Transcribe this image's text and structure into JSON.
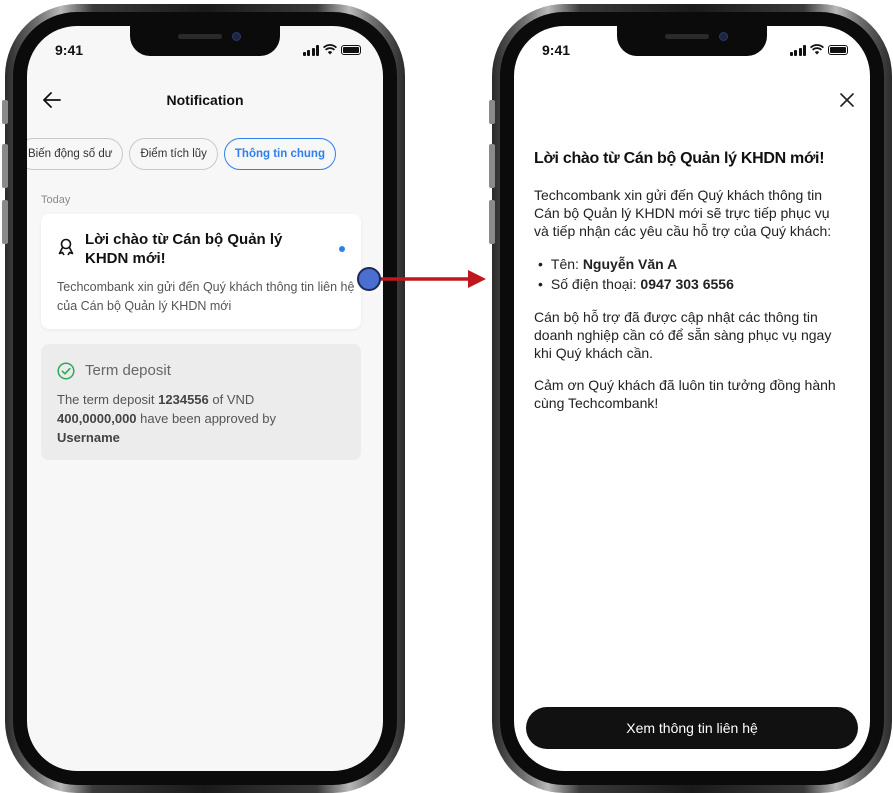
{
  "left_phone": {
    "status_time": "9:41",
    "header": {
      "title": "Notification"
    },
    "tabs": [
      {
        "label": "Biến động số dư",
        "active": false
      },
      {
        "label": "Điểm tích lũy",
        "active": false
      },
      {
        "label": "Thông tin chung",
        "active": true
      }
    ],
    "section_label": "Today",
    "notifications": [
      {
        "icon": "badge-icon",
        "title": "Lời chào từ Cán bộ Quản lý KHDN mới!",
        "body": "Techcombank xin gửi đến Quý khách thông tin liên hệ của Cán bộ Quản lý KHDN mới",
        "unread": true
      },
      {
        "icon": "check-circle-icon",
        "title": "Term deposit",
        "body_parts": {
          "p1": "The term deposit ",
          "id": "1234556",
          "p2": " of VND ",
          "amount": "400,0000,000",
          "p3": " have been approved by ",
          "user": "Username"
        },
        "unread": false
      }
    ]
  },
  "right_phone": {
    "status_time": "9:41",
    "title": "Lời chào từ Cán bộ Quản lý KHDN mới!",
    "intro": "Techcombank xin gửi đến Quý khách thông tin Cán bộ Quản lý KHDN mới sẽ trực tiếp phục vụ và tiếp nhận các yêu cầu hỗ trợ của Quý khách:",
    "contact": {
      "name_label": "Tên: ",
      "name": "Nguyễn Văn A",
      "phone_label": "Số điện thoại: ",
      "phone": "0947 303 6556"
    },
    "para2": "Cán bộ hỗ trợ đã được cập nhật các thông tin doanh nghiệp cần có để sẵn sàng phục vụ ngay khi Quý khách cần.",
    "para3": "Cảm ơn Quý khách đã luôn tin tưởng đồng hành cùng Techcombank!",
    "cta_label": "Xem thông tin liên hệ"
  },
  "colors": {
    "accent_blue": "#2f80ed",
    "arrow_red": "#c0161c",
    "marker_fill": "#4a6fd1",
    "cta_bg": "#111111"
  }
}
